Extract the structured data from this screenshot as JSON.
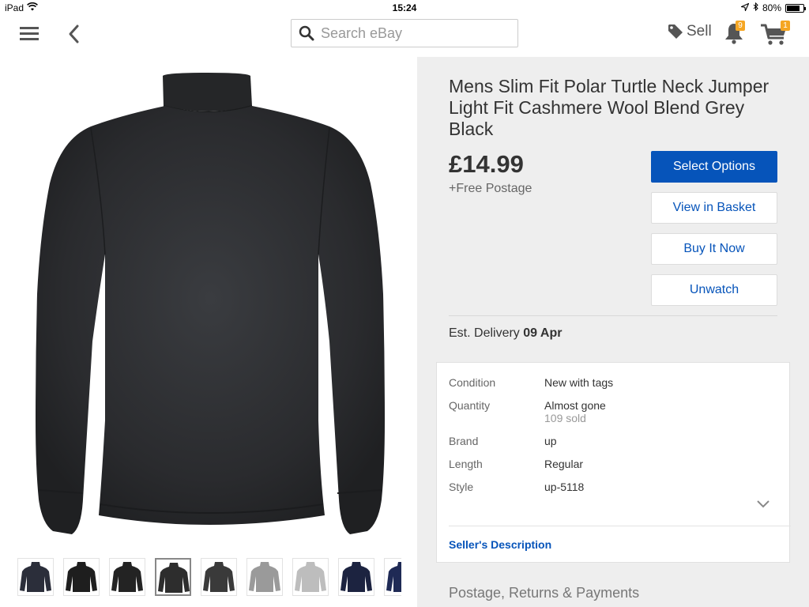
{
  "status_bar": {
    "device": "iPad",
    "time": "15:24",
    "battery_percent": "80%",
    "battery_level": 0.8
  },
  "nav": {
    "search_placeholder": "Search eBay",
    "sell_label": "Sell",
    "notifications_count": "9",
    "cart_count": "1",
    "icons": [
      "menu-icon",
      "back-chevron-icon",
      "search-icon",
      "tag-icon",
      "bell-icon",
      "cart-icon"
    ]
  },
  "colors": {
    "accent_blue": "#0654ba",
    "badge_orange": "#f5a623",
    "panel_grey": "#eeeeee"
  },
  "gallery": {
    "selected_thumb_index": 3,
    "thumbnails": [
      {
        "label": "multi",
        "color": "#2b2e3a"
      },
      {
        "label": "black",
        "color": "#1e1e1e"
      },
      {
        "label": "black",
        "color": "#232323"
      },
      {
        "label": "charcoal",
        "color": "#2d2d2d"
      },
      {
        "label": "dark grey",
        "color": "#3a3a3a"
      },
      {
        "label": "grey",
        "color": "#9a9a9a"
      },
      {
        "label": "light grey",
        "color": "#bdbdbd"
      },
      {
        "label": "navy",
        "color": "#1c2340"
      },
      {
        "label": "navy",
        "color": "#1f2a55"
      }
    ]
  },
  "listing": {
    "title": "Mens Slim Fit Polar Turtle Neck Jumper Light Fit Cashmere Wool Blend Grey Black",
    "price": "£14.99",
    "postage": "+Free Postage",
    "buttons": {
      "select_options": "Select Options",
      "view_in_basket": "View in Basket",
      "buy_it_now": "Buy It Now",
      "unwatch": "Unwatch"
    },
    "delivery_label": "Est. Delivery",
    "delivery_date": "09 Apr"
  },
  "specs": {
    "rows": [
      {
        "label": "Condition",
        "value": "New with tags"
      },
      {
        "label": "Quantity",
        "value": "Almost gone",
        "sub": "109 sold"
      },
      {
        "label": "Brand",
        "value": "up"
      },
      {
        "label": "Length",
        "value": "Regular"
      },
      {
        "label": "Style",
        "value": "up-5118"
      }
    ],
    "seller_description": "Seller's Description"
  },
  "sections": {
    "postage_returns": "Postage, Returns & Payments"
  }
}
